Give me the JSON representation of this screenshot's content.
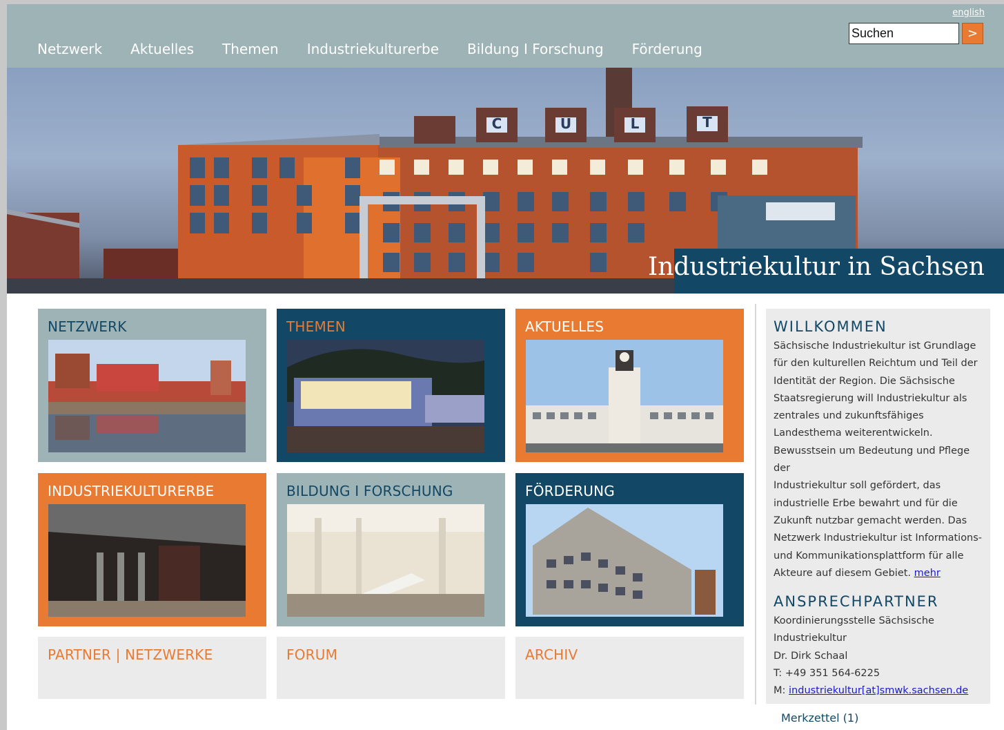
{
  "header": {
    "lang_link": "english",
    "search": {
      "value": "Suchen",
      "button_label": ">"
    },
    "nav": [
      "Netzwerk",
      "Aktuelles",
      "Themen",
      "Industriekulturerbe",
      "Bildung I Forschung",
      "Förderung"
    ]
  },
  "hero": {
    "title": "Industriekultur in Sachsen",
    "sign_letters": [
      "C",
      "U",
      "L",
      "T"
    ]
  },
  "tiles": [
    {
      "title": "NETZWERK",
      "style": "gray"
    },
    {
      "title": "THEMEN",
      "style": "navy"
    },
    {
      "title": "AKTUELLES",
      "style": "orange"
    },
    {
      "title": "INDUSTRIEKULTURERBE",
      "style": "orange"
    },
    {
      "title": "BILDUNG I FORSCHUNG",
      "style": "gray"
    },
    {
      "title": "FÖRDERUNG",
      "style": "navy"
    }
  ],
  "small_tiles": [
    "PARTNER | NETZWERKE",
    "FORUM",
    "ARCHIV"
  ],
  "sidebar": {
    "welcome_heading": "WILLKOMMEN",
    "welcome_lines": [
      "Sächsische Industriekultur ist Grundlage",
      "für den kulturellen Reichtum und Teil der",
      "Identität der Region. Die Sächsische",
      "Staatsregierung will Industriekultur als",
      "zentrales und zukunftsfähiges",
      "Landesthema weiterentwickeln.",
      "Bewusstsein um Bedeutung und Pflege der",
      "Industriekultur soll gefördert, das",
      "industrielle Erbe bewahrt und für die",
      "Zukunft nutzbar gemacht werden. Das",
      "Netzwerk Industriekultur ist Informations-",
      "und Kommunikationsplattform für alle"
    ],
    "welcome_last_line": "Akteure auf diesem Gebiet.",
    "more_link": "mehr",
    "contact_heading": "ANSPRECHPARTNER",
    "contact_lines": [
      "Koordinierungsstelle Sächsische",
      "Industriekultur",
      "Dr. Dirk Schaal",
      "T: +49 351 564-6225"
    ],
    "email_prefix": "M:",
    "email": "industriekultur[at]smwk.sachsen.de"
  },
  "merkzettel": "Merkzettel (1)",
  "colors": {
    "gray": "#9eb3b5",
    "navy": "#124866",
    "orange": "#e87a32",
    "light": "#ebebeb"
  }
}
